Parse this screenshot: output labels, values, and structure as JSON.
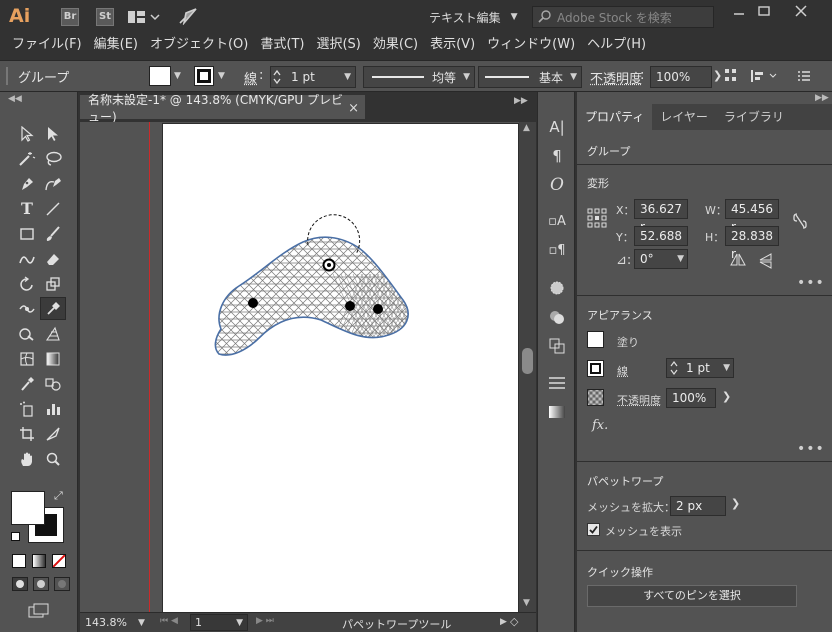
{
  "app": {
    "logo": "Ai",
    "bridge": "Br",
    "stock": "St",
    "workspace": "テキスト編集",
    "search_placeholder": "Adobe Stock を検索"
  },
  "menus": [
    "ファイル(F)",
    "編集(E)",
    "オブジェクト(O)",
    "書式(T)",
    "選択(S)",
    "効果(C)",
    "表示(V)",
    "ウィンドウ(W)",
    "ヘルプ(H)"
  ],
  "control": {
    "selection": "グループ",
    "stroke_label": "線",
    "stroke_weight": "1 pt",
    "stroke_profile": "均等",
    "brush": "基本",
    "opacity_label": "不透明度",
    "opacity": "100%"
  },
  "document": {
    "tab_title": "名称未設定-1* @ 143.8% (CMYK/GPU プレビュー)",
    "close": "×"
  },
  "status": {
    "zoom": "143.8%",
    "artboard": "1",
    "tool": "パペットワープツール"
  },
  "panel": {
    "tabs": [
      "プロパティ",
      "レイヤー",
      "ライブラリ"
    ],
    "selection_type": "グループ",
    "transform": {
      "title": "変形",
      "x_label": "X：",
      "x": "36.627 r",
      "y_label": "Y：",
      "y": "52.688 r",
      "w_label": "W：",
      "w": "45.456 r",
      "h_label": "H：",
      "h": "28.838 r",
      "angle": "0°"
    },
    "appearance": {
      "title": "アピアランス",
      "fill": "塗り",
      "stroke": "線",
      "stroke_weight": "1 pt",
      "opacity_label": "不透明度",
      "opacity": "100%",
      "fx": "fx."
    },
    "puppet": {
      "title": "パペットワープ",
      "expand_label": "メッシュを拡大：",
      "expand": "2 px",
      "show_mesh": "メッシュを表示"
    },
    "quick": {
      "title": "クイック操作",
      "select_pins": "すべてのピンを選択"
    }
  },
  "colors": {
    "accent": "#e7a15f",
    "guide": "#cc2a2a",
    "path": "#4a6fa5"
  }
}
